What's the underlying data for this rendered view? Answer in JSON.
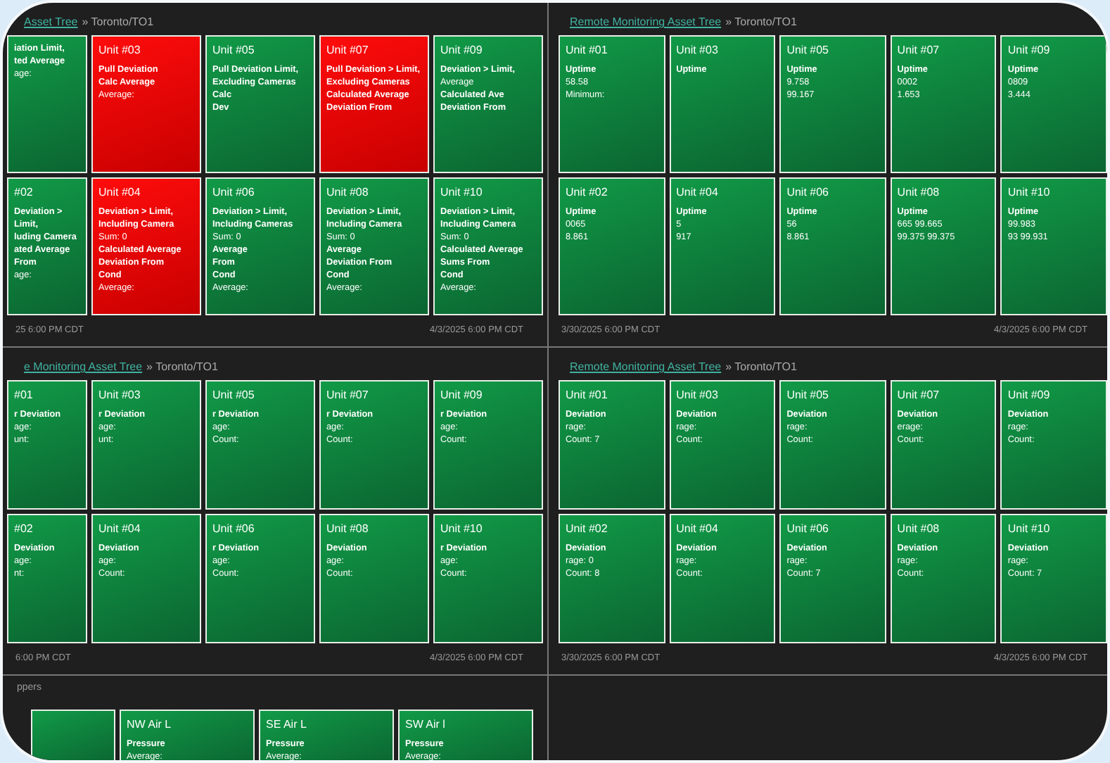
{
  "panels": [
    {
      "breadcrumb_link": "Asset Tree",
      "breadcrumb_path": "» Toronto/TO1",
      "tiles": [
        {
          "alert": false,
          "lines": [
            {
              "text": "iation  Limit,",
              "kind": "heading"
            },
            {
              "text": "ted Average",
              "kind": "heading"
            },
            {
              "text": "age:",
              "kind": "value"
            }
          ]
        },
        {
          "title": "Unit #03",
          "alert": true,
          "lines": [
            {
              "text": "Pull Deviation",
              "kind": "heading"
            },
            {
              "text": "Calc    Average",
              "kind": "heading"
            },
            {
              "text": "Average:",
              "kind": "value"
            }
          ]
        },
        {
          "title": "Unit #05",
          "alert": false,
          "lines": [
            {
              "text": "Pull Deviation  Limit,",
              "kind": "heading"
            },
            {
              "text": "Excluding Cameras",
              "kind": "heading"
            },
            {
              "text": "Calc",
              "kind": "heading"
            },
            {
              "text": "Dev",
              "kind": "heading"
            }
          ]
        },
        {
          "title": "Unit #07",
          "alert": true,
          "lines": [
            {
              "text": "Pull Deviation > Limit,",
              "kind": "heading"
            },
            {
              "text": "Excluding Cameras",
              "kind": "heading"
            },
            {
              "text": "Calculated Average",
              "kind": "heading"
            },
            {
              "text": "Deviation From",
              "kind": "heading"
            }
          ]
        },
        {
          "title": "Unit #09",
          "alert": false,
          "lines": [
            {
              "text": "Deviation > Limit,",
              "kind": "heading"
            },
            {
              "text": "Average",
              "kind": "value"
            },
            {
              "text": "Calculated Ave",
              "kind": "heading"
            },
            {
              "text": "Deviation From",
              "kind": "heading"
            }
          ]
        },
        {
          "title": "#02",
          "alert": false,
          "lines": [
            {
              "text": "Deviation > Limit,",
              "kind": "heading"
            },
            {
              "text": "luding Camera",
              "kind": "heading"
            },
            {
              "text": "ated Average",
              "kind": "heading"
            },
            {
              "text": "From",
              "kind": "heading"
            },
            {
              "text": "age:",
              "kind": "value"
            }
          ]
        },
        {
          "title": "Unit #04",
          "alert": true,
          "lines": [
            {
              "text": "Deviation > Limit,",
              "kind": "heading"
            },
            {
              "text": "Including Camera",
              "kind": "heading"
            },
            {
              "text": "Sum: 0",
              "kind": "value"
            },
            {
              "text": "Calculated Average",
              "kind": "heading"
            },
            {
              "text": "Deviation From",
              "kind": "heading"
            },
            {
              "text": "Cond",
              "kind": "heading"
            },
            {
              "text": "Average:",
              "kind": "value"
            }
          ]
        },
        {
          "title": "Unit #06",
          "alert": false,
          "lines": [
            {
              "text": "Deviation > Limit,",
              "kind": "heading"
            },
            {
              "text": "Including Cameras",
              "kind": "heading"
            },
            {
              "text": "Sum: 0",
              "kind": "value"
            },
            {
              "text": "Average",
              "kind": "heading"
            },
            {
              "text": "From",
              "kind": "heading"
            },
            {
              "text": "Cond",
              "kind": "heading"
            },
            {
              "text": "Average:",
              "kind": "value"
            }
          ]
        },
        {
          "title": "Unit #08",
          "alert": false,
          "lines": [
            {
              "text": "Deviation > Limit,",
              "kind": "heading"
            },
            {
              "text": "Including Camera",
              "kind": "heading"
            },
            {
              "text": "Sum: 0",
              "kind": "value"
            },
            {
              "text": "Average",
              "kind": "heading"
            },
            {
              "text": "Deviation From",
              "kind": "heading"
            },
            {
              "text": "Cond",
              "kind": "heading"
            },
            {
              "text": "Average:",
              "kind": "value"
            }
          ]
        },
        {
          "title": "Unit #10",
          "alert": false,
          "lines": [
            {
              "text": "Deviation > Limit,",
              "kind": "heading"
            },
            {
              "text": "Including Camera",
              "kind": "heading"
            },
            {
              "text": "Sum: 0",
              "kind": "value"
            },
            {
              "text": "Calculated Average",
              "kind": "heading"
            },
            {
              "text": "Sums From",
              "kind": "heading"
            },
            {
              "text": "Cond",
              "kind": "heading"
            },
            {
              "text": "Average:",
              "kind": "value"
            }
          ]
        }
      ],
      "start_time": "25 6:00 PM  CDT",
      "end_time": "4/3/2025 6:00 PM  CDT"
    },
    {
      "breadcrumb_link": "Remote Monitoring Asset Tree",
      "breadcrumb_path": "» Toronto/TO1",
      "tiles": [
        {
          "title": "Unit #01",
          "alert": false,
          "lines": [
            {
              "text": "Uptime",
              "kind": "heading"
            },
            {
              "text": "58.58",
              "kind": "value"
            },
            {
              "text": "Minimum:",
              "kind": "value"
            }
          ]
        },
        {
          "title": "Unit #03",
          "alert": false,
          "lines": [
            {
              "text": "Uptime",
              "kind": "heading"
            }
          ]
        },
        {
          "title": "Unit #05",
          "alert": false,
          "lines": [
            {
              "text": "Uptime",
              "kind": "heading"
            },
            {
              "text": "9.758",
              "kind": "value"
            },
            {
              "text": "99.167",
              "kind": "value"
            }
          ]
        },
        {
          "title": "Unit #07",
          "alert": false,
          "lines": [
            {
              "text": "Uptime",
              "kind": "heading"
            },
            {
              "text": "0002",
              "kind": "value"
            },
            {
              "text": "1.653",
              "kind": "value"
            }
          ]
        },
        {
          "title": "Unit #09",
          "alert": false,
          "lines": [
            {
              "text": "Uptime",
              "kind": "heading"
            },
            {
              "text": "0809",
              "kind": "value"
            },
            {
              "text": "3.444",
              "kind": "value"
            }
          ]
        },
        {
          "title": "Unit #02",
          "alert": false,
          "lines": [
            {
              "text": "Uptime",
              "kind": "heading"
            },
            {
              "text": "0065",
              "kind": "value"
            },
            {
              "text": "8.861",
              "kind": "value"
            }
          ]
        },
        {
          "title": "Unit #04",
          "alert": false,
          "lines": [
            {
              "text": "Uptime",
              "kind": "heading"
            },
            {
              "text": "5",
              "kind": "value"
            },
            {
              "text": "917",
              "kind": "value"
            }
          ]
        },
        {
          "title": "Unit #06",
          "alert": false,
          "lines": [
            {
              "text": "Uptime",
              "kind": "heading"
            },
            {
              "text": "56",
              "kind": "value"
            },
            {
              "text": "8.861",
              "kind": "value"
            }
          ]
        },
        {
          "title": "Unit #08",
          "alert": false,
          "lines": [
            {
              "text": "Uptime",
              "kind": "heading"
            },
            {
              "text": "665 99.665",
              "kind": "value"
            },
            {
              "text": "99.375 99.375",
              "kind": "value"
            }
          ]
        },
        {
          "title": "Unit #10",
          "alert": false,
          "lines": [
            {
              "text": "Uptime",
              "kind": "heading"
            },
            {
              "text": "99.983",
              "kind": "value"
            },
            {
              "text": "93 99.931",
              "kind": "value"
            }
          ]
        }
      ],
      "start_time": "3/30/2025 6:00 PM  CDT",
      "end_time": "4/3/2025 6:00 PM  CDT"
    },
    {
      "breadcrumb_link": "e Monitoring Asset Tree",
      "breadcrumb_path": "» Toronto/TO1",
      "tiles": [
        {
          "title": "#01",
          "alert": false,
          "lines": [
            {
              "text": "r Deviation",
              "kind": "heading"
            },
            {
              "text": "age:",
              "kind": "value"
            },
            {
              "text": "unt:",
              "kind": "value"
            }
          ]
        },
        {
          "title": "Unit #03",
          "alert": false,
          "lines": [
            {
              "text": "r Deviation",
              "kind": "heading"
            },
            {
              "text": "age:",
              "kind": "value"
            },
            {
              "text": "unt:",
              "kind": "value"
            }
          ]
        },
        {
          "title": "Unit #05",
          "alert": false,
          "lines": [
            {
              "text": "r Deviation",
              "kind": "heading"
            },
            {
              "text": "age:",
              "kind": "value"
            },
            {
              "text": "Count:",
              "kind": "value"
            }
          ]
        },
        {
          "title": "Unit #07",
          "alert": false,
          "lines": [
            {
              "text": "r Deviation",
              "kind": "heading"
            },
            {
              "text": "age:",
              "kind": "value"
            },
            {
              "text": "Count:",
              "kind": "value"
            }
          ]
        },
        {
          "title": "Unit #09",
          "alert": false,
          "lines": [
            {
              "text": "r Deviation",
              "kind": "heading"
            },
            {
              "text": "age:",
              "kind": "value"
            },
            {
              "text": "Count:",
              "kind": "value"
            }
          ]
        },
        {
          "title": "#02",
          "alert": false,
          "lines": [
            {
              "text": "Deviation",
              "kind": "heading"
            },
            {
              "text": "age:",
              "kind": "value"
            },
            {
              "text": "nt:",
              "kind": "value"
            }
          ]
        },
        {
          "title": "Unit #04",
          "alert": false,
          "lines": [
            {
              "text": "Deviation",
              "kind": "heading"
            },
            {
              "text": "age:",
              "kind": "value"
            },
            {
              "text": "Count:",
              "kind": "value"
            }
          ]
        },
        {
          "title": "Unit #06",
          "alert": false,
          "lines": [
            {
              "text": "r Deviation",
              "kind": "heading"
            },
            {
              "text": "age:",
              "kind": "value"
            },
            {
              "text": "Count:",
              "kind": "value"
            }
          ]
        },
        {
          "title": "Unit #08",
          "alert": false,
          "lines": [
            {
              "text": "Deviation",
              "kind": "heading"
            },
            {
              "text": "age:",
              "kind": "value"
            },
            {
              "text": "Count:",
              "kind": "value"
            }
          ]
        },
        {
          "title": "Unit #10",
          "alert": false,
          "lines": [
            {
              "text": "r Deviation",
              "kind": "heading"
            },
            {
              "text": "age:",
              "kind": "value"
            },
            {
              "text": "Count:",
              "kind": "value"
            }
          ]
        }
      ],
      "start_time": "6:00 PM  CDT",
      "end_time": "4/3/2025 6:00 PM  CDT"
    },
    {
      "breadcrumb_link": "Remote Monitoring Asset Tree",
      "breadcrumb_path": "» Toronto/TO1",
      "tiles": [
        {
          "title": "Unit #01",
          "alert": false,
          "lines": [
            {
              "text": "Deviation",
              "kind": "heading"
            },
            {
              "text": "rage:",
              "kind": "value"
            },
            {
              "text": "Count: 7",
              "kind": "value"
            }
          ]
        },
        {
          "title": "Unit #03",
          "alert": false,
          "lines": [
            {
              "text": "Deviation",
              "kind": "heading"
            },
            {
              "text": "rage:",
              "kind": "value"
            },
            {
              "text": "Count:",
              "kind": "value"
            }
          ]
        },
        {
          "title": "Unit #05",
          "alert": false,
          "lines": [
            {
              "text": "Deviation",
              "kind": "heading"
            },
            {
              "text": "rage:",
              "kind": "value"
            },
            {
              "text": "Count:",
              "kind": "value"
            }
          ]
        },
        {
          "title": "Unit #07",
          "alert": false,
          "lines": [
            {
              "text": "Deviation",
              "kind": "heading"
            },
            {
              "text": "erage:",
              "kind": "value"
            },
            {
              "text": "Count:",
              "kind": "value"
            }
          ]
        },
        {
          "title": "Unit #09",
          "alert": false,
          "lines": [
            {
              "text": "Deviation",
              "kind": "heading"
            },
            {
              "text": "rage:",
              "kind": "value"
            },
            {
              "text": "Count:",
              "kind": "value"
            }
          ]
        },
        {
          "title": "Unit #02",
          "alert": false,
          "lines": [
            {
              "text": "Deviation",
              "kind": "heading"
            },
            {
              "text": "rage: 0",
              "kind": "value"
            },
            {
              "text": "Count: 8",
              "kind": "value"
            }
          ]
        },
        {
          "title": "Unit #04",
          "alert": false,
          "lines": [
            {
              "text": "Deviation",
              "kind": "heading"
            },
            {
              "text": "rage:",
              "kind": "value"
            },
            {
              "text": "Count:",
              "kind": "value"
            }
          ]
        },
        {
          "title": "Unit #06",
          "alert": false,
          "lines": [
            {
              "text": "Deviation",
              "kind": "heading"
            },
            {
              "text": "rage:",
              "kind": "value"
            },
            {
              "text": "Count: 7",
              "kind": "value"
            }
          ]
        },
        {
          "title": "Unit #08",
          "alert": false,
          "lines": [
            {
              "text": "Deviation",
              "kind": "heading"
            },
            {
              "text": "rage:",
              "kind": "value"
            },
            {
              "text": "Count:",
              "kind": "value"
            }
          ]
        },
        {
          "title": "Unit #10",
          "alert": false,
          "lines": [
            {
              "text": "Deviation",
              "kind": "heading"
            },
            {
              "text": "rage:",
              "kind": "value"
            },
            {
              "text": "Count: 7",
              "kind": "value"
            }
          ]
        }
      ],
      "start_time": "3/30/2025 6:00 PM  CDT",
      "end_time": "4/3/2025 6:00 PM  CDT"
    }
  ],
  "bottom_panel": {
    "title": "ppers",
    "tiles": [
      {
        "kind": "partial"
      },
      {
        "kind": "sensor",
        "title": "NW Air L",
        "lines": [
          {
            "text": "Pressure",
            "kind": "heading"
          },
          {
            "text": "Average:",
            "kind": "value"
          }
        ]
      },
      {
        "kind": "sensor",
        "title": "SE Air L",
        "lines": [
          {
            "text": "Pressure",
            "kind": "heading"
          },
          {
            "text": "Average:",
            "kind": "value"
          }
        ]
      },
      {
        "kind": "sensor",
        "title": "SW Air l",
        "lines": [
          {
            "text": "Pressure",
            "kind": "heading"
          },
          {
            "text": "Average:",
            "kind": "value"
          }
        ]
      }
    ]
  }
}
